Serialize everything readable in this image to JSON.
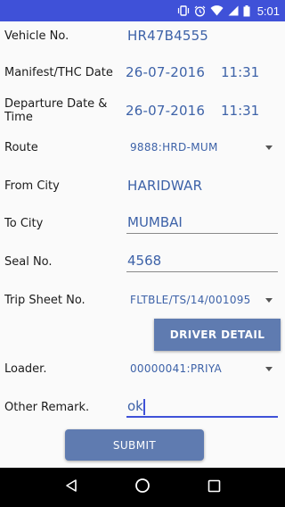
{
  "status_bar": {
    "time": "5:01"
  },
  "form": {
    "vehicle_no": {
      "label": "Vehicle No.",
      "value": "HR47B4555"
    },
    "manifest": {
      "label": "Manifest/THC Date",
      "date": "26-07-2016",
      "time": "11:31"
    },
    "departure": {
      "label_line1": "Departure Date &",
      "label_line2": "Time",
      "date": "26-07-2016",
      "time": "11:31"
    },
    "route": {
      "label": "Route",
      "selected": "9888:HRD-MUM"
    },
    "from_city": {
      "label": "From City",
      "value": "HARIDWAR"
    },
    "to_city": {
      "label": "To City",
      "value": "MUMBAI"
    },
    "seal_no": {
      "label": "Seal No.",
      "value": "4568"
    },
    "trip_sheet": {
      "label": "Trip Sheet No.",
      "selected": "FLTBLE/TS/14/001095"
    },
    "driver_detail_button": "DRIVER DETAIL",
    "loader": {
      "label": "Loader.",
      "selected": "00000041:PRIYA"
    },
    "other_remark": {
      "label": "Other Remark.",
      "value": "ok"
    },
    "submit_button": "SUBMIT"
  },
  "colors": {
    "status_bar": "#3f51d8",
    "value_text": "#3d62a8",
    "button": "#5f7bb0"
  },
  "icons": [
    "vibrate-icon",
    "alarm-icon",
    "wifi-icon",
    "signal-icon",
    "battery-icon",
    "back-icon",
    "home-icon",
    "recents-icon"
  ]
}
